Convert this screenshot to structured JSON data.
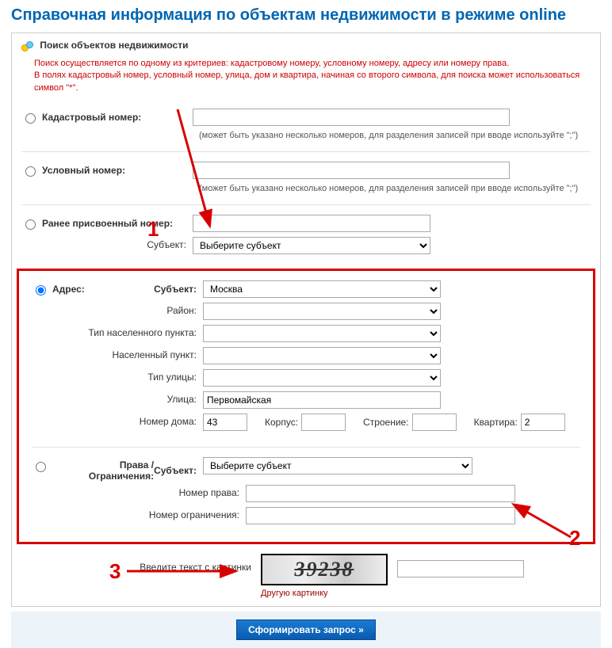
{
  "page": {
    "title": "Справочная информация по объектам недвижимости в режиме online",
    "panel_title": "Поиск объектов недвижимости"
  },
  "hints": {
    "by_criteria": "Поиск осуществляется по одному из критериев: кадастровому номеру, условному номеру, адресу или номеру права.",
    "filter": "В полях кадастровый номер, условный номер, улица, дом и квартира, начиная со второго символа, для поиска может использоваться символ \"*\"."
  },
  "cad": {
    "label": "Кадастровый номер:",
    "value": "",
    "note": "(может быть указано несколько номеров, для разделения записей при вводе используйте \";\")"
  },
  "cond": {
    "label": "Условный номер:",
    "value": "",
    "note": "(может быть указано несколько номеров, для разделения записей при вводе используйте \";\")"
  },
  "prev": {
    "label": "Ранее присвоенный номер:",
    "value": "",
    "subject_label": "Субъект:",
    "subject_value": "Выберите субъект"
  },
  "address": {
    "label": "Адрес:",
    "subject_label": "Субъект:",
    "subject_value": "Москва",
    "district_label": "Район:",
    "district_value": "",
    "settlement_type_label": "Тип населенного пункта:",
    "settlement_type_value": "",
    "settlement_label": "Населенный пункт:",
    "settlement_value": "",
    "street_type_label": "Тип улицы:",
    "street_type_value": "",
    "street_label": "Улица:",
    "street_value": "Первомайская",
    "house_label": "Номер дома:",
    "house_value": "43",
    "korpus_label": "Корпус:",
    "korpus_value": "",
    "stroenie_label": "Строение:",
    "stroenie_value": "",
    "flat_label": "Квартира:",
    "flat_value": "2"
  },
  "rights": {
    "label": "Права / Ограничения:",
    "subject_label": "Субъект:",
    "subject_value": "Выберите субъект",
    "right_no_label": "Номер права:",
    "right_no_value": "",
    "restrict_no_label": "Номер ограничения:",
    "restrict_no_value": ""
  },
  "captcha": {
    "label": "Введите текст с картинки",
    "image_text": "39238",
    "another_link": "Другую картинку",
    "input_value": ""
  },
  "submit": {
    "label": "Сформировать запрос »"
  },
  "annotations": {
    "n1": "1",
    "n2": "2",
    "n3": "3"
  }
}
